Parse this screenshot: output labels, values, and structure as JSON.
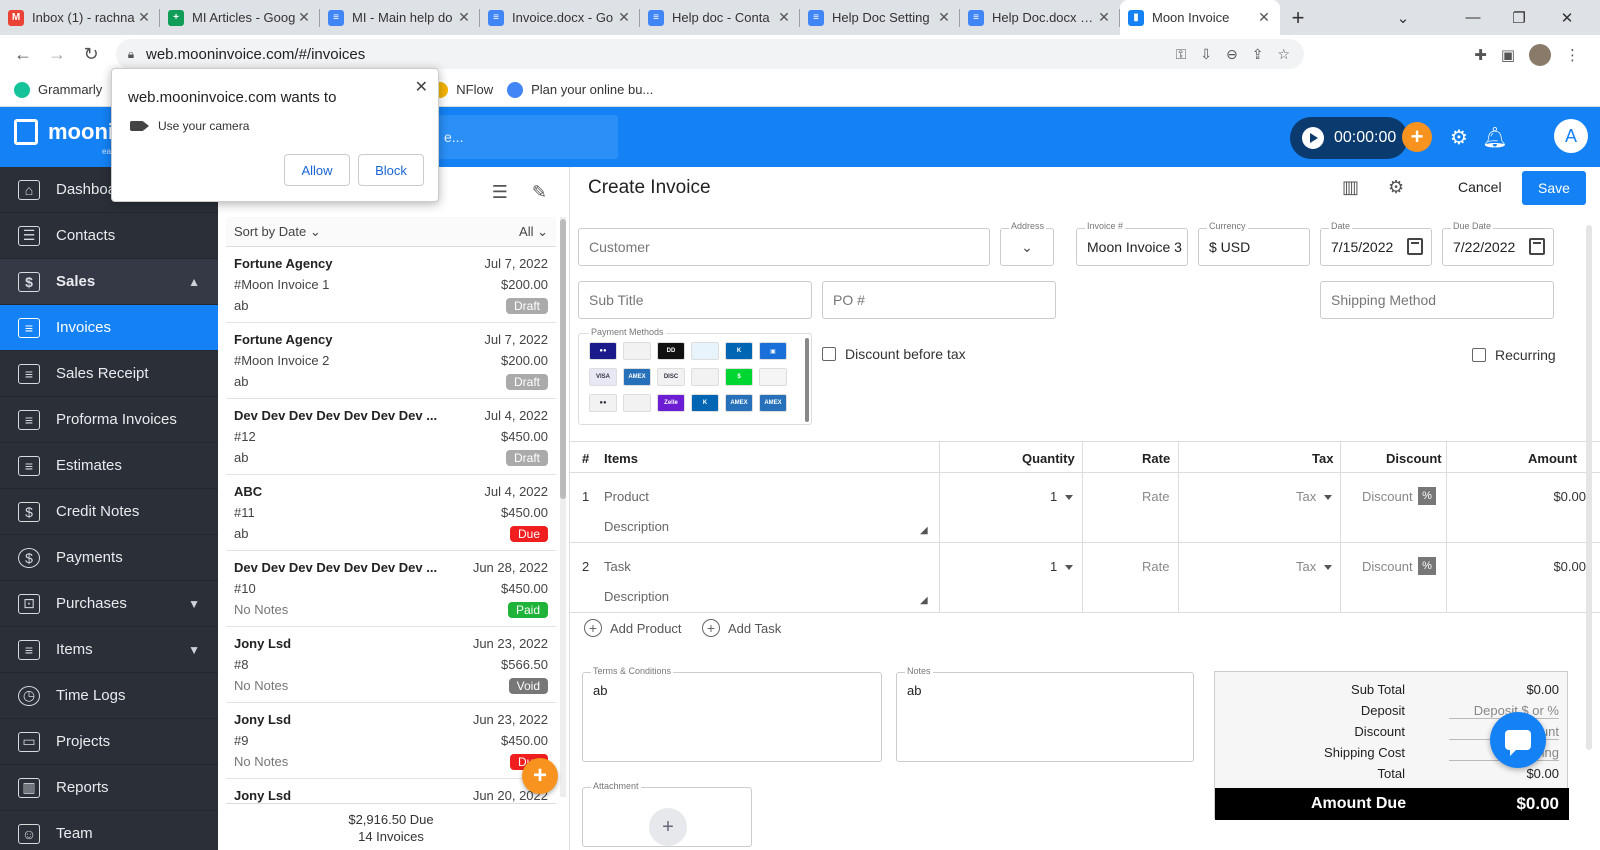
{
  "browser": {
    "tabs": [
      {
        "title": "Inbox (1) - rachna",
        "favicon": "gmail-icon",
        "color": "#ea4335",
        "glyph": "M"
      },
      {
        "title": "MI Articles - Goog",
        "favicon": "sheets-icon",
        "color": "#0f9d58",
        "glyph": "+"
      },
      {
        "title": "MI - Main help do",
        "favicon": "docs-icon",
        "color": "#4285f4",
        "glyph": "≡"
      },
      {
        "title": "Invoice.docx - Go",
        "favicon": "docs-icon",
        "color": "#4285f4",
        "glyph": "≡"
      },
      {
        "title": "Help doc - Conta",
        "favicon": "docs-icon",
        "color": "#4285f4",
        "glyph": "≡"
      },
      {
        "title": "Help Doc Setting",
        "favicon": "docs-icon",
        "color": "#4285f4",
        "glyph": "≡"
      },
      {
        "title": "Help Doc.docx - G",
        "favicon": "docs-icon",
        "color": "#4285f4",
        "glyph": "≡"
      },
      {
        "title": "Moon Invoice",
        "favicon": "moon-invoice-icon",
        "color": "#1482f5",
        "glyph": "▮",
        "active": true
      }
    ],
    "url": "web.mooninvoice.com/#/invoices",
    "bookmarks": [
      {
        "label": "Grammarly",
        "color": "#15c39a"
      },
      {
        "label": "NFlow",
        "color": "#f4b400"
      },
      {
        "label": "Plan your online bu...",
        "color": "#4285f4"
      }
    ]
  },
  "permission": {
    "title": "web.mooninvoice.com wants to",
    "request": "Use your camera",
    "allow": "Allow",
    "block": "Block"
  },
  "app": {
    "logo": "moonin",
    "logo_sub": "ea",
    "search_text": "e...",
    "timer": "00:00:00",
    "avatar": "A",
    "accent": "#1482f5"
  },
  "sidebar": {
    "items": [
      {
        "label": "Dashboard",
        "icon": "home-icon",
        "glyph": "⌂"
      },
      {
        "label": "Contacts",
        "icon": "contacts-icon",
        "glyph": "☰"
      },
      {
        "label": "Sales",
        "icon": "dollar-icon",
        "glyph": "$",
        "chev": "▲",
        "bold": true
      },
      {
        "label": "Invoices",
        "icon": "invoice-icon",
        "glyph": "≡",
        "active": true
      },
      {
        "label": "Sales Receipt",
        "icon": "receipt-icon",
        "glyph": "≡"
      },
      {
        "label": "Proforma Invoices",
        "icon": "proforma-icon",
        "glyph": "≡"
      },
      {
        "label": "Estimates",
        "icon": "estimate-icon",
        "glyph": "≡"
      },
      {
        "label": "Credit Notes",
        "icon": "credit-note-icon",
        "glyph": "$"
      },
      {
        "label": "Payments",
        "icon": "payments-icon",
        "glyph": "$",
        "round": true
      },
      {
        "label": "Purchases",
        "icon": "purchases-icon",
        "glyph": "⊡",
        "chev": "▼"
      },
      {
        "label": "Items",
        "icon": "items-icon",
        "glyph": "≡",
        "chev": "▼"
      },
      {
        "label": "Time Logs",
        "icon": "clock-icon",
        "glyph": "◷",
        "round": true
      },
      {
        "label": "Projects",
        "icon": "folder-icon",
        "glyph": "▭"
      },
      {
        "label": "Reports",
        "icon": "reports-icon",
        "glyph": "▥"
      },
      {
        "label": "Team",
        "icon": "team-icon",
        "glyph": "☺"
      }
    ]
  },
  "list": {
    "sort_label": "Sort by Date",
    "filter_label": "All",
    "invoices": [
      {
        "customer": "Fortune Agency",
        "date": "Jul 7, 2022",
        "number": "#Moon Invoice 1",
        "amount": "$200.00",
        "note": "ab",
        "status": "Draft",
        "status_class": "b-draft"
      },
      {
        "customer": "Fortune Agency",
        "date": "Jul 7, 2022",
        "number": "#Moon Invoice 2",
        "amount": "$200.00",
        "note": "ab",
        "status": "Draft",
        "status_class": "b-draft"
      },
      {
        "customer": "Dev Dev Dev Dev Dev Dev Dev ...",
        "date": "Jul 4, 2022",
        "number": "#12",
        "amount": "$450.00",
        "note": "ab",
        "status": "Draft",
        "status_class": "b-draft"
      },
      {
        "customer": "ABC",
        "date": "Jul 4, 2022",
        "number": "#11",
        "amount": "$450.00",
        "note": "ab",
        "status": "Due",
        "status_class": "b-due"
      },
      {
        "customer": "Dev Dev Dev Dev Dev Dev Dev ...",
        "date": "Jun 28, 2022",
        "number": "#10",
        "amount": "$450.00",
        "note": "No Notes",
        "status": "Paid",
        "status_class": "b-paid"
      },
      {
        "customer": "Jony Lsd",
        "date": "Jun 23, 2022",
        "number": "#8",
        "amount": "$566.50",
        "note": "No Notes",
        "status": "Void",
        "status_class": "b-void"
      },
      {
        "customer": "Jony Lsd",
        "date": "Jun 23, 2022",
        "number": "#9",
        "amount": "$450.00",
        "note": "No Notes",
        "status": "Due",
        "status_class": "b-due"
      },
      {
        "customer": "Jony Lsd",
        "date": "Jun 20, 2022",
        "number": "",
        "amount": "",
        "note": "",
        "status": "",
        "status_class": ""
      }
    ],
    "footer_due": "$2,916.50  Due",
    "footer_count": "14 Invoices"
  },
  "form": {
    "title": "Create Invoice",
    "cancel": "Cancel",
    "save": "Save",
    "customer_placeholder": "Customer",
    "address_label": "Address",
    "invoice_label": "Invoice #",
    "invoice_value": "Moon Invoice 3",
    "currency_label": "Currency",
    "currency_value": "$ USD",
    "date_label": "Date",
    "date_value": "7/15/2022",
    "due_label": "Due Date",
    "due_value": "7/22/2022",
    "subtitle_placeholder": "Sub Title",
    "po_placeholder": "PO #",
    "shipping_placeholder": "Shipping Method",
    "payment_methods_label": "Payment Methods",
    "payment_cards": [
      {
        "name": "maestro-icon",
        "text": "●●",
        "color": "#1a1a8c"
      },
      {
        "name": "card-icon",
        "text": "",
        "color": "#f2f2f2"
      },
      {
        "name": "dd-icon",
        "text": "DD",
        "color": "#111111"
      },
      {
        "name": "bank-icon",
        "text": "",
        "color": "#e8f4fb"
      },
      {
        "name": "klarna-icon",
        "text": "K",
        "color": "#0066b3"
      },
      {
        "name": "cash-icon",
        "text": "▣",
        "color": "#1a6fd8"
      },
      {
        "name": "visa-icon",
        "text": "VISA",
        "color": "#e8e8f5"
      },
      {
        "name": "amex-icon",
        "text": "AMEX",
        "color": "#2671b9"
      },
      {
        "name": "discover-icon",
        "text": "DISC",
        "color": "#f2f2f2"
      },
      {
        "name": "stripe-icon",
        "text": "",
        "color": "#f2f2f2"
      },
      {
        "name": "cashapp-icon",
        "text": "$",
        "color": "#00d632"
      },
      {
        "name": "settle-icon",
        "text": "",
        "color": "#f5f5f5"
      },
      {
        "name": "mastercard-icon",
        "text": "●●",
        "color": "#f2f2f2"
      },
      {
        "name": "cheque-icon",
        "text": "",
        "color": "#f2f2f2"
      },
      {
        "name": "zelle-icon",
        "text": "Zelle",
        "color": "#6d1ed4"
      },
      {
        "name": "klarna-2-icon",
        "text": "K",
        "color": "#0066b3"
      },
      {
        "name": "amex-2-icon",
        "text": "AMEX",
        "color": "#2671b9"
      },
      {
        "name": "amex-3-icon",
        "text": "AMEX",
        "color": "#2671b9"
      }
    ],
    "discount_before_tax": "Discount before tax",
    "recurring": "Recurring",
    "columns": {
      "num": "#",
      "items": "Items",
      "quantity": "Quantity",
      "rate": "Rate",
      "tax": "Tax",
      "discount": "Discount",
      "amount": "Amount"
    },
    "rows": [
      {
        "num": "1",
        "item": "Product",
        "desc": "Description",
        "qty": "1",
        "rate": "Rate",
        "tax": "Tax",
        "discount": "Discount",
        "pct": "%",
        "amount": "$0.00"
      },
      {
        "num": "2",
        "item": "Task",
        "desc": "Description",
        "qty": "1",
        "rate": "Rate",
        "tax": "Tax",
        "discount": "Discount",
        "pct": "%",
        "amount": "$0.00"
      }
    ],
    "add_product": "Add Product",
    "add_task": "Add Task",
    "terms_label": "Terms & Conditions",
    "terms_value": "ab",
    "notes_label": "Notes",
    "notes_value": "ab",
    "attachment_label": "Attachment",
    "totals": {
      "sub_total_label": "Sub Total",
      "sub_total": "$0.00",
      "deposit_label": "Deposit",
      "deposit_placeholder": "Deposit $ or %",
      "discount_label": "Discount",
      "discount_placeholder": "Discount",
      "shipping_label": "Shipping Cost",
      "shipping_placeholder": "Shipping",
      "total_label": "Total",
      "total": "$0.00",
      "amount_due_label": "Amount Due",
      "amount_due": "$0.00"
    }
  }
}
